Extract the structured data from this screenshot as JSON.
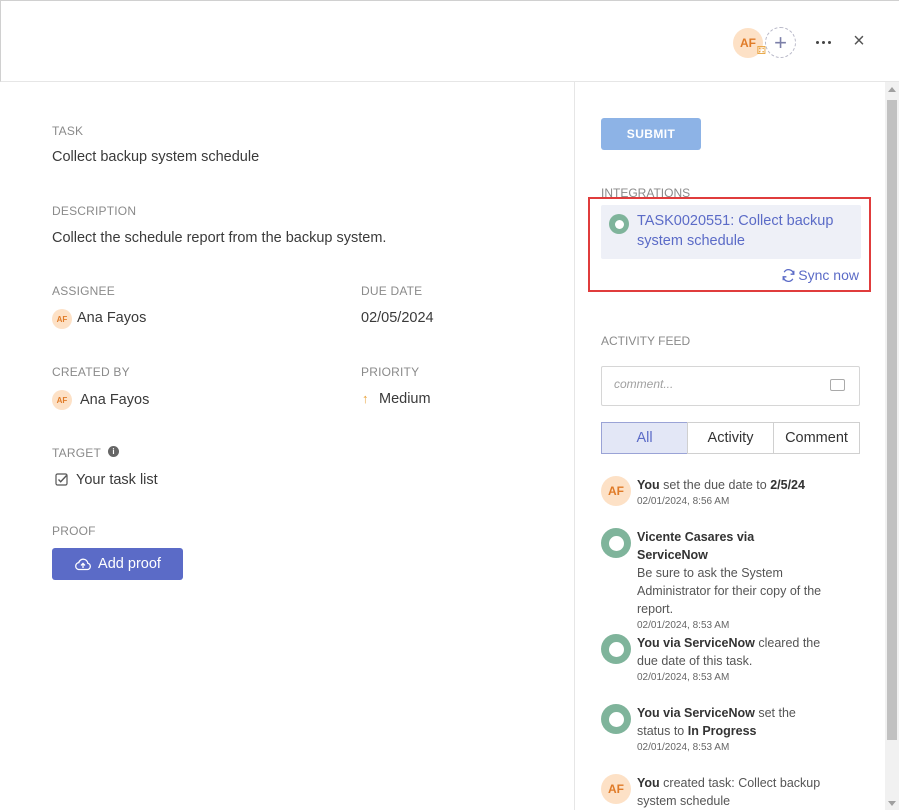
{
  "header": {
    "avatar_initials": "AF",
    "add_collaborator_symbol": "+",
    "more_icon": "more-horizontal-icon",
    "close_symbol": "×"
  },
  "task": {
    "task_label": "TASK",
    "task_value": "Collect backup system schedule",
    "description_label": "DESCRIPTION",
    "description_value": "Collect the schedule report from the backup system.",
    "assignee_label": "ASSIGNEE",
    "assignee_initials": "AF",
    "assignee_name": "Ana Fayos",
    "due_date_label": "DUE DATE",
    "due_date_value": "02/05/2024",
    "created_by_label": "CREATED BY",
    "created_by_initials": "AF",
    "created_by_name": "Ana Fayos",
    "priority_label": "PRIORITY",
    "priority_value": "Medium",
    "target_label": "TARGET",
    "target_value": "Your task list",
    "proof_label": "PROOF",
    "add_proof_label": "Add proof"
  },
  "sidebar": {
    "submit_label": "SUBMIT",
    "integrations_label": "INTEGRATIONS",
    "integration_title": "TASK0020551: Collect backup system schedule",
    "sync_label": "Sync now",
    "activity_label": "ACTIVITY FEED",
    "comment_placeholder": "comment...",
    "tabs": [
      "All",
      "Activity",
      "Comment"
    ],
    "active_tab": "All"
  },
  "feed": [
    {
      "avatar": "AF",
      "actor": "You",
      "text": " set the due date to ",
      "bold_suffix": "2/5/24",
      "time": "02/01/2024, 8:56 AM"
    },
    {
      "avatar": "servicenow",
      "actor": "Vicente Casares via ServiceNow",
      "text": "Be sure to ask the System Administrator for their copy of the report.",
      "time": "02/01/2024, 8:53 AM"
    },
    {
      "avatar": "servicenow",
      "actor": "You via ServiceNow",
      "text": " cleared the due date of this task.",
      "time": "02/01/2024, 8:53 AM"
    },
    {
      "avatar": "servicenow",
      "actor": "You via ServiceNow",
      "text": " set the status to ",
      "bold_suffix": "In Progress",
      "time": "02/01/2024, 8:53 AM"
    },
    {
      "avatar": "AF",
      "actor": "You",
      "text": " created task: Collect backup system schedule",
      "time": ""
    }
  ],
  "colors": {
    "accent": "#5b6bc7",
    "submit": "#8db3e6",
    "highlight_border": "#e03c3c",
    "avatar_bg": "#fde1c6",
    "servicenow": "#7fb49b"
  }
}
